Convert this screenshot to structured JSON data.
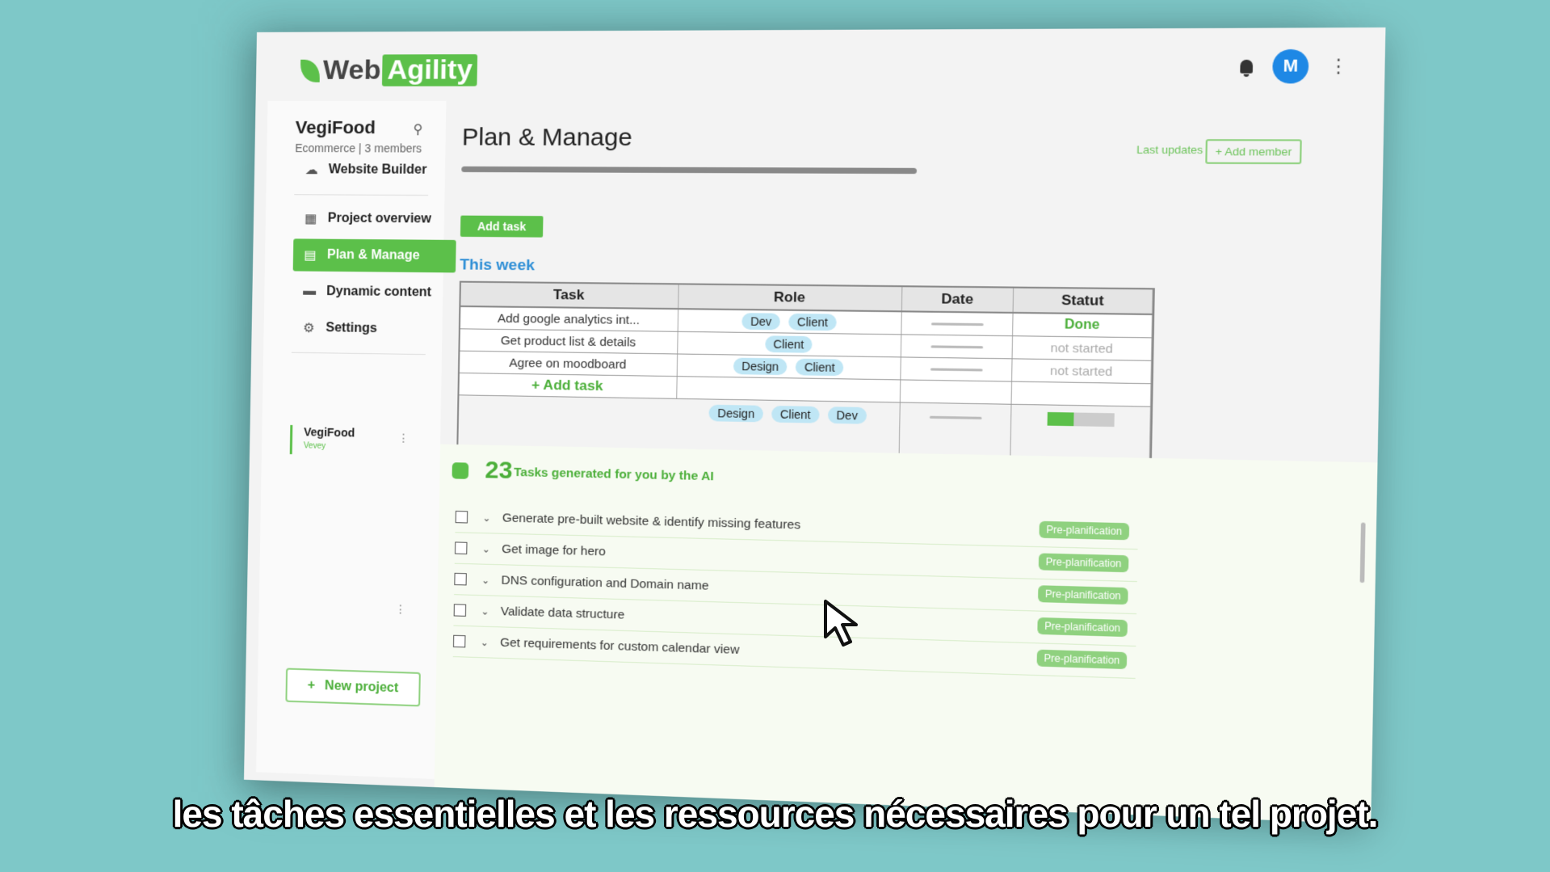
{
  "app": {
    "logo_web": "Web",
    "logo_agility": "Agility",
    "avatar_initial": "M"
  },
  "sidebar": {
    "project_name": "VegiFood",
    "project_sub": "Ecommerce | 3 members",
    "items": [
      {
        "label": "Website Builder",
        "icon": "cloud-icon"
      },
      {
        "label": "Project overview",
        "icon": "dashboard-icon"
      },
      {
        "label": "Plan & Manage",
        "icon": "calendar-icon",
        "active": true
      },
      {
        "label": "Dynamic content",
        "icon": "folder-icon"
      },
      {
        "label": "Settings",
        "icon": "gear-icon"
      }
    ],
    "projects": [
      {
        "name": "VegiFood",
        "location": "Vevey"
      }
    ],
    "new_project_label": "New project"
  },
  "main": {
    "title": "Plan & Manage",
    "last_updates": "Last updates",
    "add_member": "+ Add member",
    "add_task_button": "Add task",
    "section_title": "This week",
    "table": {
      "headers": [
        "Task",
        "Role",
        "Date",
        "Statut"
      ],
      "rows": [
        {
          "task": "Add google analytics int...",
          "roles": [
            "Dev",
            "Client"
          ],
          "status": "Done"
        },
        {
          "task": "Get product list & details",
          "roles": [
            "Client"
          ],
          "status": "not started"
        },
        {
          "task": "Agree on moodboard",
          "roles": [
            "Design",
            "Client"
          ],
          "status": "not started"
        }
      ],
      "add_task_row": "+ Add task",
      "summary_roles": [
        "Design",
        "Client",
        "Dev"
      ],
      "summary_progress": 0.4
    },
    "ai": {
      "count": "23",
      "label": "Tasks generated for you by the AI",
      "items": [
        {
          "text": "Generate pre-built website & identify missing features",
          "tag": "Pre-planification"
        },
        {
          "text": "Get image for hero",
          "tag": "Pre-planification"
        },
        {
          "text": "DNS configuration and Domain name",
          "tag": "Pre-planification"
        },
        {
          "text": "Validate data structure",
          "tag": "Pre-planification"
        },
        {
          "text": "Get requirements for custom calendar view",
          "tag": "Pre-planification"
        }
      ]
    }
  },
  "subtitle": "les tâches essentielles et les ressources nécessaires pour un tel projet.",
  "colors": {
    "accent": "#5cc04a",
    "avatar": "#1e88e5",
    "section_title": "#2f8fd6",
    "background": "#7ec8c8"
  }
}
